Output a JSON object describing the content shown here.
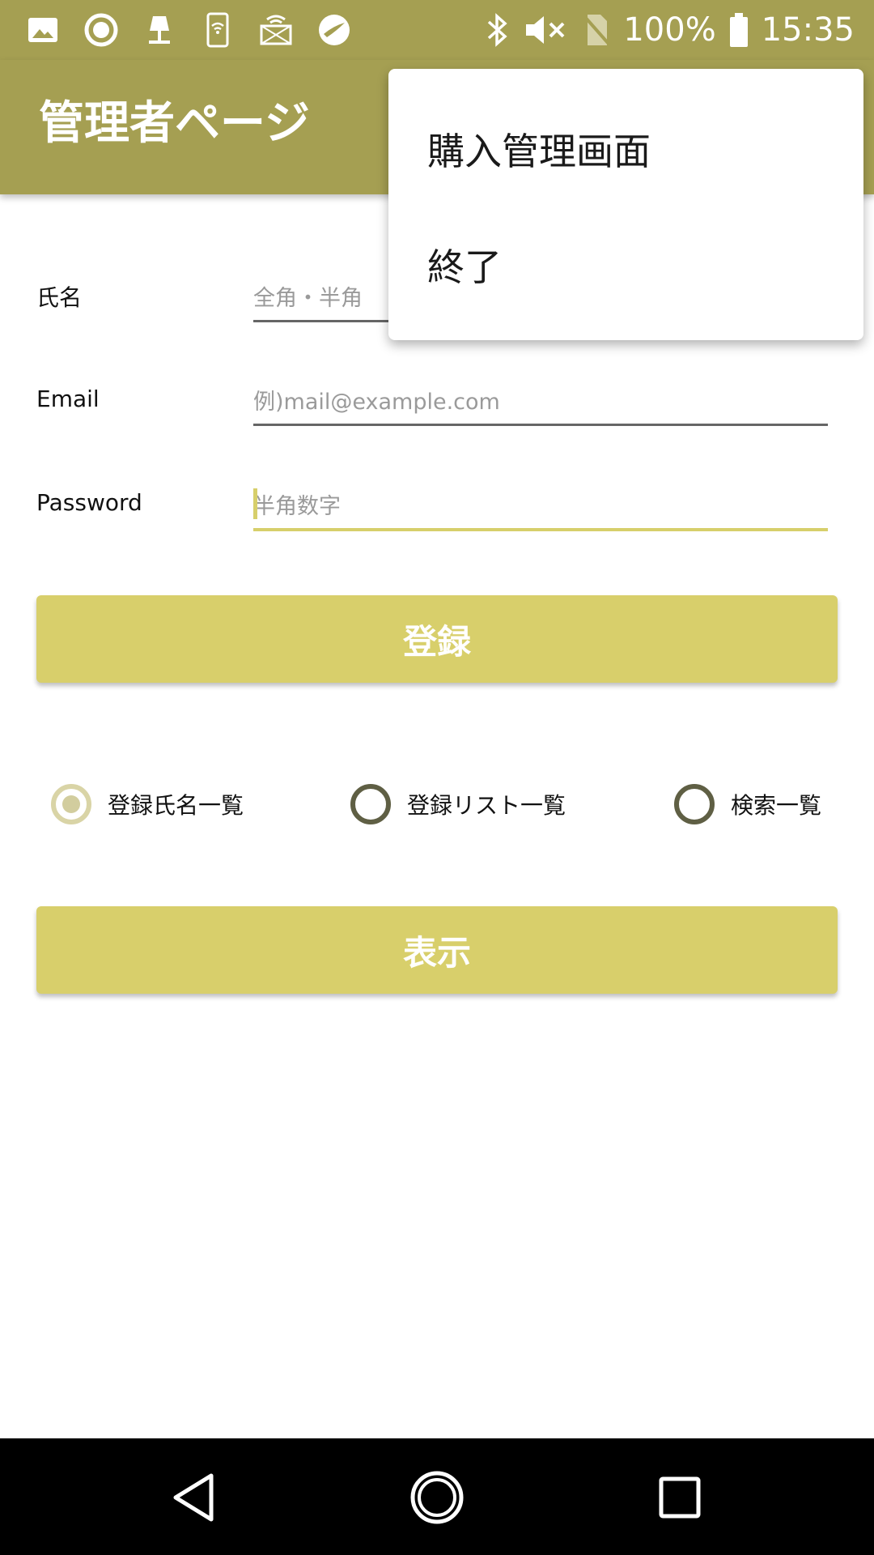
{
  "status_bar": {
    "battery_percent": "100%",
    "time": "15:35"
  },
  "app_bar": {
    "title": "管理者ページ"
  },
  "form": {
    "name": {
      "label": "氏名",
      "placeholder": "全角・半角"
    },
    "email": {
      "label": "Email",
      "placeholder": "例)mail@example.com"
    },
    "password": {
      "label": "Password",
      "placeholder": "半角数字"
    },
    "register_button": "登録"
  },
  "radio_group": {
    "options": [
      {
        "label": "登録氏名一覧",
        "checked": true
      },
      {
        "label": "登録リスト一覧",
        "checked": false
      },
      {
        "label": "検索一覧",
        "checked": false
      }
    ]
  },
  "display_button": "表示",
  "overflow_menu": {
    "items": [
      "購入管理画面",
      "終了"
    ]
  },
  "colors": {
    "app_bar": "#a59f52",
    "button": "#d8cf6b",
    "focus_underline": "#d7cf6b"
  }
}
